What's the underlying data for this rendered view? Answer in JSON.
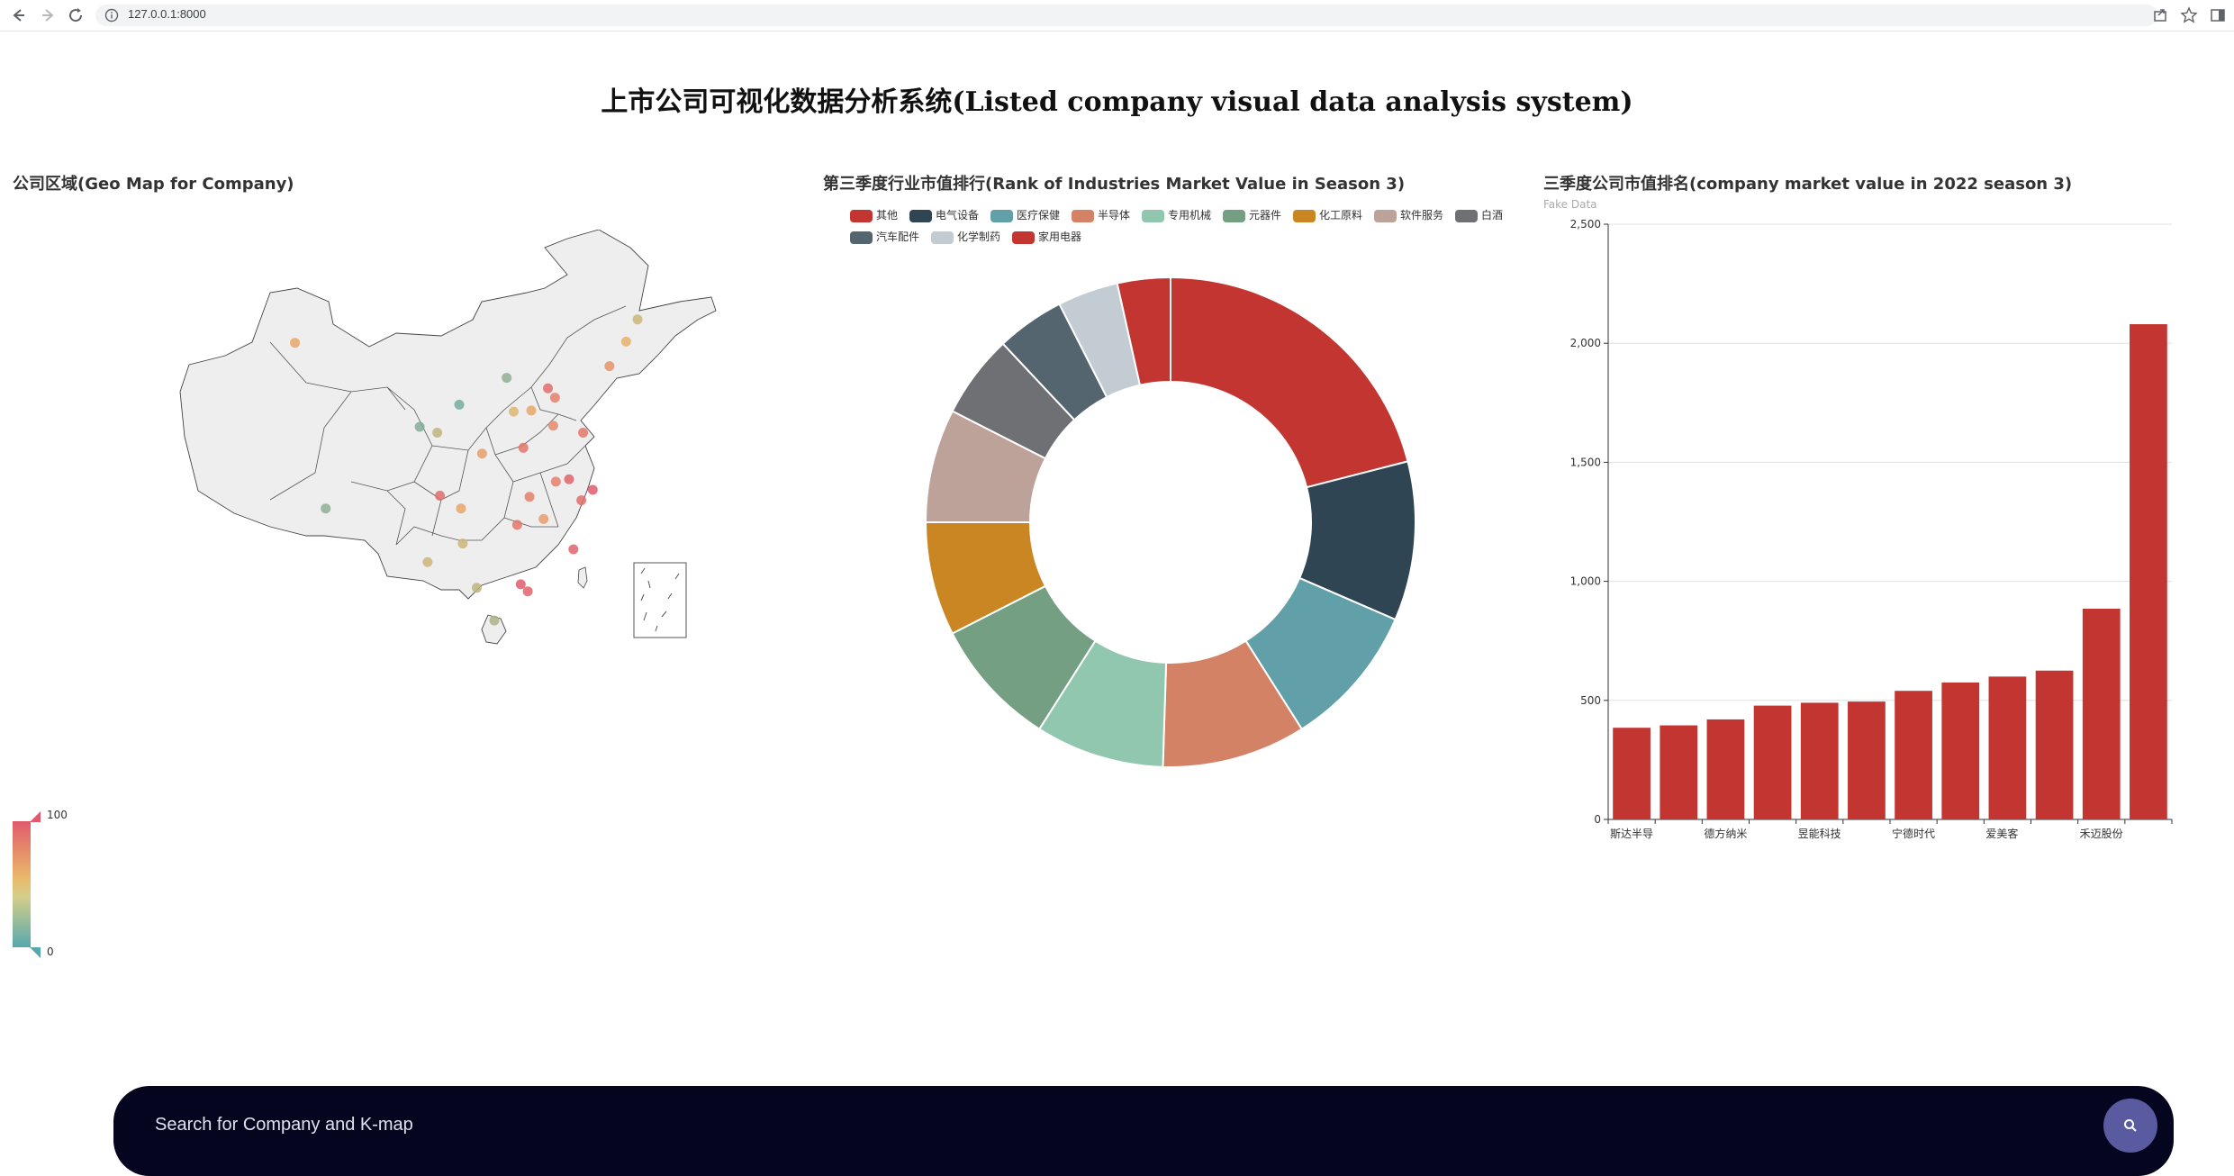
{
  "browser": {
    "url": "127.0.0.1:8000",
    "icons": [
      "back-icon",
      "forward-icon",
      "reload-icon",
      "info-icon",
      "share-icon",
      "star-icon",
      "sidebar-icon"
    ]
  },
  "page": {
    "title": "上市公司可视化数据分析系统(Listed company visual data analysis system)"
  },
  "map_panel": {
    "title": "公司区域(Geo Map for Company)",
    "visual_map": {
      "max_label": "100",
      "min_label": "0",
      "colors": [
        "#e05a6b",
        "#e9b96a",
        "#57a7ae"
      ]
    }
  },
  "pie_panel": {
    "title": "第三季度行业市值排行(Rank of Industries Market Value in Season 3)"
  },
  "bar_panel": {
    "title": "三季度公司市值排名(company market value in 2022 season 3)",
    "subtitle": "Fake Data"
  },
  "search": {
    "placeholder": "Search for Company and K-map",
    "icon": "search-icon"
  },
  "chart_data": [
    {
      "type": "pie",
      "title": "第三季度行业市值排行(Rank of Industries Market Value in Season 3)",
      "legend_position": "top",
      "categories": [
        "其他",
        "电气设备",
        "医疗保健",
        "半导体",
        "专用机械",
        "元器件",
        "化工原料",
        "软件服务",
        "白酒",
        "汽车配件",
        "化学制药",
        "家用电器"
      ],
      "values": [
        21.0,
        10.5,
        9.5,
        9.5,
        8.5,
        8.5,
        7.5,
        7.5,
        5.5,
        4.5,
        4.0,
        3.5
      ],
      "colors": [
        "#c23531",
        "#2f4554",
        "#61a0a8",
        "#d48265",
        "#91c7ae",
        "#749f83",
        "#ca8622",
        "#bda29a",
        "#6e7074",
        "#546570",
        "#c4ccd3",
        "#c23531"
      ]
    },
    {
      "type": "bar",
      "title": "三季度公司市值排名(company market value in 2022 season 3)",
      "subtitle": "Fake Data",
      "categories": [
        "斯达半导",
        "",
        "德方纳米",
        "",
        "昱能科技",
        "",
        "宁德时代",
        "",
        "爱美客",
        "",
        "禾迈股份",
        ""
      ],
      "values": [
        385,
        395,
        420,
        478,
        490,
        495,
        540,
        575,
        600,
        625,
        885,
        2080
      ],
      "ylim": [
        0,
        2500
      ],
      "yticks": [
        "0",
        "500",
        "1,000",
        "1,500",
        "2,000",
        "2,500"
      ],
      "grid": true,
      "color": "#c23531"
    },
    {
      "type": "scatter",
      "title": "公司区域(Geo Map for Company)",
      "x_unit": "longitude",
      "y_unit": "latitude",
      "points": [
        {
          "x": 87.6,
          "y": 43.8,
          "value": 60
        },
        {
          "x": 91.1,
          "y": 29.6,
          "value": 20
        },
        {
          "x": 101.8,
          "y": 36.6,
          "value": 15
        },
        {
          "x": 106.3,
          "y": 38.5,
          "value": 10
        },
        {
          "x": 103.8,
          "y": 36.1,
          "value": 35
        },
        {
          "x": 111.7,
          "y": 40.8,
          "value": 20
        },
        {
          "x": 116.4,
          "y": 39.9,
          "value": 90
        },
        {
          "x": 117.2,
          "y": 39.1,
          "value": 80
        },
        {
          "x": 114.5,
          "y": 38.0,
          "value": 60
        },
        {
          "x": 112.5,
          "y": 37.9,
          "value": 45
        },
        {
          "x": 123.4,
          "y": 41.8,
          "value": 70
        },
        {
          "x": 125.3,
          "y": 43.9,
          "value": 55
        },
        {
          "x": 126.6,
          "y": 45.8,
          "value": 40
        },
        {
          "x": 117.0,
          "y": 36.7,
          "value": 75
        },
        {
          "x": 120.4,
          "y": 36.1,
          "value": 85
        },
        {
          "x": 118.8,
          "y": 32.1,
          "value": 95
        },
        {
          "x": 121.5,
          "y": 31.2,
          "value": 100
        },
        {
          "x": 120.2,
          "y": 30.3,
          "value": 90
        },
        {
          "x": 117.3,
          "y": 31.9,
          "value": 80
        },
        {
          "x": 113.6,
          "y": 34.8,
          "value": 85
        },
        {
          "x": 108.9,
          "y": 34.3,
          "value": 65
        },
        {
          "x": 114.3,
          "y": 30.6,
          "value": 80
        },
        {
          "x": 112.9,
          "y": 28.2,
          "value": 85
        },
        {
          "x": 115.9,
          "y": 28.7,
          "value": 65
        },
        {
          "x": 119.3,
          "y": 26.1,
          "value": 95
        },
        {
          "x": 113.3,
          "y": 23.1,
          "value": 100
        },
        {
          "x": 114.1,
          "y": 22.5,
          "value": 95
        },
        {
          "x": 108.3,
          "y": 22.8,
          "value": 35
        },
        {
          "x": 106.7,
          "y": 26.6,
          "value": 40
        },
        {
          "x": 102.7,
          "y": 25.0,
          "value": 40
        },
        {
          "x": 104.1,
          "y": 30.7,
          "value": 90
        },
        {
          "x": 106.5,
          "y": 29.6,
          "value": 60
        },
        {
          "x": 110.3,
          "y": 20.0,
          "value": 30
        }
      ]
    }
  ]
}
